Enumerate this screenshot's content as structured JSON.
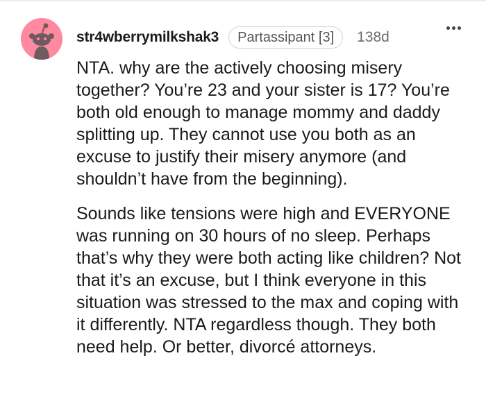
{
  "comment": {
    "username": "str4wberrymilkshak3",
    "flair": "Partassipant [3]",
    "age": "138d",
    "more_icon": "more-options-icon",
    "avatar_color": "#ff8aa0",
    "paragraphs": [
      "NTA. why are the actively choosing misery together? You’re 23 and your sister is 17? You’re both old enough to manage mommy and daddy splitting up. They cannot use you both as an excuse to justify their misery anymore (and shouldn’t have from the beginning).",
      "Sounds like tensions were high and EVERYONE was running on 30 hours of no sleep. Perhaps that’s why they were both acting like children? Not that it’s an excuse, but I think everyone in this situation was stressed to the max and coping with it differently. NTA regardless though. They both need help. Or better, divorcé attorneys."
    ]
  }
}
